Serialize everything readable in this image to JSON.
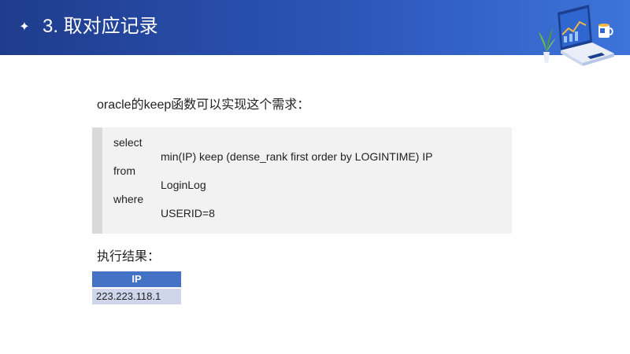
{
  "header": {
    "bullet_icon": "four-point-star-icon",
    "title": "3. 取对应记录",
    "illustration_icon": "laptop-chart-illustration"
  },
  "intro": "oracle的keep函数可以实现这个需求：",
  "code": {
    "lines": [
      "select",
      "min(IP) keep (dense_rank first order by LOGINTIME) IP",
      "from",
      "LoginLog",
      "where",
      "USERID=8"
    ]
  },
  "result": {
    "label": "执行结果：",
    "table": {
      "header": "IP",
      "rows": [
        "223.223.118.1"
      ]
    }
  },
  "colors": {
    "header_gradient_start": "#1f3c8c",
    "header_gradient_end": "#3d74da",
    "code_background": "#f2f2f2",
    "code_border": "#d9d9d9",
    "table_header": "#4472c4",
    "table_row": "#cfd5ea"
  }
}
